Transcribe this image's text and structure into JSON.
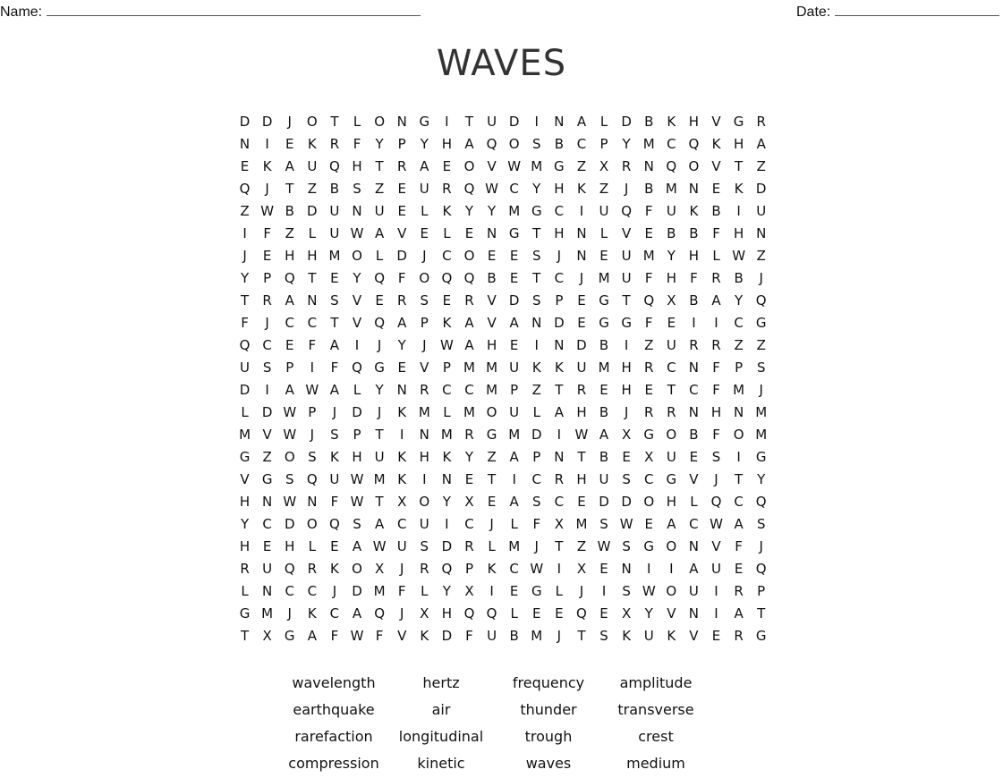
{
  "header": {
    "name_label": "Name:",
    "date_label": "Date:"
  },
  "title": "WAVES",
  "grid": [
    [
      "D",
      "D",
      "J",
      "O",
      "T",
      "L",
      "O",
      "N",
      "G",
      "I",
      "T",
      "U",
      "D",
      "I",
      "N",
      "A",
      "L",
      "D",
      "B",
      "K",
      "H",
      "V",
      "G",
      "R"
    ],
    [
      "N",
      "I",
      "E",
      "K",
      "R",
      "F",
      "Y",
      "P",
      "Y",
      "H",
      "A",
      "Q",
      "O",
      "S",
      "B",
      "C",
      "P",
      "Y",
      "M",
      "C",
      "Q",
      "K",
      "H",
      "A"
    ],
    [
      "E",
      "K",
      "A",
      "U",
      "Q",
      "H",
      "T",
      "R",
      "A",
      "E",
      "O",
      "V",
      "W",
      "M",
      "G",
      "Z",
      "X",
      "R",
      "N",
      "Q",
      "O",
      "V",
      "T",
      "Z"
    ],
    [
      "Q",
      "J",
      "T",
      "Z",
      "B",
      "S",
      "Z",
      "E",
      "U",
      "R",
      "Q",
      "W",
      "C",
      "Y",
      "H",
      "K",
      "Z",
      "J",
      "B",
      "M",
      "N",
      "E",
      "K",
      "D"
    ],
    [
      "Z",
      "W",
      "B",
      "D",
      "U",
      "N",
      "U",
      "E",
      "L",
      "K",
      "Y",
      "Y",
      "M",
      "G",
      "C",
      "I",
      "U",
      "Q",
      "F",
      "U",
      "K",
      "B",
      "I",
      "U"
    ],
    [
      "I",
      "F",
      "Z",
      "L",
      "U",
      "W",
      "A",
      "V",
      "E",
      "L",
      "E",
      "N",
      "G",
      "T",
      "H",
      "N",
      "L",
      "V",
      "E",
      "B",
      "B",
      "F",
      "H",
      "N"
    ],
    [
      "J",
      "E",
      "H",
      "H",
      "M",
      "O",
      "L",
      "D",
      "J",
      "C",
      "O",
      "E",
      "E",
      "S",
      "J",
      "N",
      "E",
      "U",
      "M",
      "Y",
      "H",
      "L",
      "W",
      "Z"
    ],
    [
      "Y",
      "P",
      "Q",
      "T",
      "E",
      "Y",
      "Q",
      "F",
      "O",
      "Q",
      "Q",
      "B",
      "E",
      "T",
      "C",
      "J",
      "M",
      "U",
      "F",
      "H",
      "F",
      "R",
      "B",
      "J"
    ],
    [
      "T",
      "R",
      "A",
      "N",
      "S",
      "V",
      "E",
      "R",
      "S",
      "E",
      "R",
      "V",
      "D",
      "S",
      "P",
      "E",
      "G",
      "T",
      "Q",
      "X",
      "B",
      "A",
      "Y",
      "Q"
    ],
    [
      "F",
      "J",
      "C",
      "C",
      "T",
      "V",
      "Q",
      "A",
      "P",
      "K",
      "A",
      "V",
      "A",
      "N",
      "D",
      "E",
      "G",
      "G",
      "F",
      "E",
      "I",
      "I",
      "C",
      "G"
    ],
    [
      "Q",
      "C",
      "E",
      "F",
      "A",
      "I",
      "J",
      "Y",
      "J",
      "W",
      "A",
      "H",
      "E",
      "I",
      "N",
      "D",
      "B",
      "I",
      "Z",
      "U",
      "R",
      "R",
      "Z",
      "Z"
    ],
    [
      "U",
      "S",
      "P",
      "I",
      "F",
      "Q",
      "G",
      "E",
      "V",
      "P",
      "M",
      "M",
      "U",
      "K",
      "K",
      "U",
      "M",
      "H",
      "R",
      "C",
      "N",
      "F",
      "P",
      "S"
    ],
    [
      "D",
      "I",
      "A",
      "W",
      "A",
      "L",
      "Y",
      "N",
      "R",
      "C",
      "C",
      "M",
      "P",
      "Z",
      "T",
      "R",
      "E",
      "H",
      "E",
      "T",
      "C",
      "F",
      "M",
      "J"
    ],
    [
      "L",
      "D",
      "W",
      "P",
      "J",
      "D",
      "J",
      "K",
      "M",
      "L",
      "M",
      "O",
      "U",
      "L",
      "A",
      "H",
      "B",
      "J",
      "R",
      "R",
      "N",
      "H",
      "N",
      "M"
    ],
    [
      "M",
      "V",
      "W",
      "J",
      "S",
      "P",
      "T",
      "I",
      "N",
      "M",
      "R",
      "G",
      "M",
      "D",
      "I",
      "W",
      "A",
      "X",
      "G",
      "O",
      "B",
      "F",
      "O",
      "M"
    ],
    [
      "G",
      "Z",
      "O",
      "S",
      "K",
      "H",
      "U",
      "K",
      "H",
      "K",
      "Y",
      "Z",
      "A",
      "P",
      "N",
      "T",
      "B",
      "E",
      "X",
      "U",
      "E",
      "S",
      "I",
      "G"
    ],
    [
      "V",
      "G",
      "S",
      "Q",
      "U",
      "W",
      "M",
      "K",
      "I",
      "N",
      "E",
      "T",
      "I",
      "C",
      "R",
      "H",
      "U",
      "S",
      "C",
      "G",
      "V",
      "J",
      "T",
      "Y"
    ],
    [
      "H",
      "N",
      "W",
      "N",
      "F",
      "W",
      "T",
      "X",
      "O",
      "Y",
      "X",
      "E",
      "A",
      "S",
      "C",
      "E",
      "D",
      "D",
      "O",
      "H",
      "L",
      "Q",
      "C",
      "Q"
    ],
    [
      "Y",
      "C",
      "D",
      "O",
      "Q",
      "S",
      "A",
      "C",
      "U",
      "I",
      "C",
      "J",
      "L",
      "F",
      "X",
      "M",
      "S",
      "W",
      "E",
      "A",
      "C",
      "W",
      "A",
      "S"
    ],
    [
      "H",
      "E",
      "H",
      "L",
      "E",
      "A",
      "W",
      "U",
      "S",
      "D",
      "R",
      "L",
      "M",
      "J",
      "T",
      "Z",
      "W",
      "S",
      "G",
      "O",
      "N",
      "V",
      "F",
      "J"
    ],
    [
      "R",
      "U",
      "Q",
      "R",
      "K",
      "O",
      "X",
      "J",
      "R",
      "Q",
      "P",
      "K",
      "C",
      "W",
      "I",
      "X",
      "E",
      "N",
      "I",
      "I",
      "A",
      "U",
      "E",
      "Q"
    ],
    [
      "L",
      "N",
      "C",
      "C",
      "J",
      "D",
      "M",
      "F",
      "L",
      "Y",
      "X",
      "I",
      "E",
      "G",
      "L",
      "J",
      "I",
      "S",
      "W",
      "O",
      "U",
      "I",
      "R",
      "P"
    ],
    [
      "G",
      "M",
      "J",
      "K",
      "C",
      "A",
      "Q",
      "J",
      "X",
      "H",
      "Q",
      "Q",
      "L",
      "E",
      "E",
      "Q",
      "E",
      "X",
      "Y",
      "V",
      "N",
      "I",
      "A",
      "T"
    ],
    [
      "T",
      "X",
      "G",
      "A",
      "F",
      "W",
      "F",
      "V",
      "K",
      "D",
      "F",
      "U",
      "B",
      "M",
      "J",
      "T",
      "S",
      "K",
      "U",
      "K",
      "V",
      "E",
      "R",
      "G"
    ]
  ],
  "word_bank": [
    "wavelength",
    "hertz",
    "frequency",
    "amplitude",
    "earthquake",
    "air",
    "thunder",
    "transverse",
    "rarefaction",
    "longitudinal",
    "trough",
    "crest",
    "compression",
    "kinetic",
    "waves",
    "medium"
  ]
}
